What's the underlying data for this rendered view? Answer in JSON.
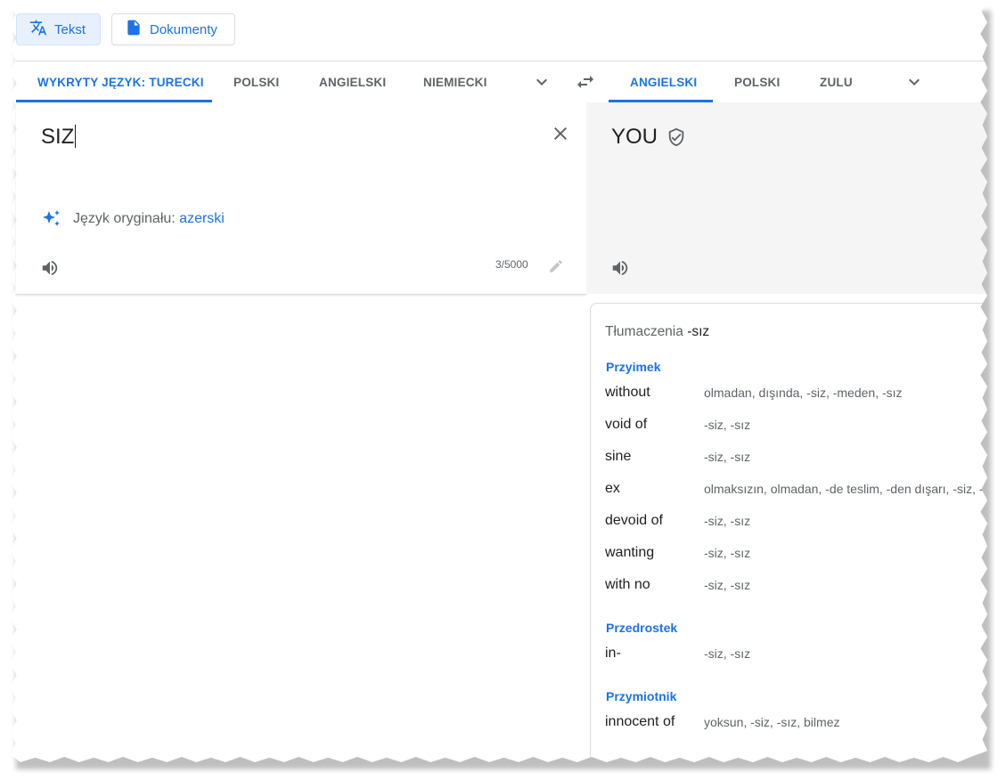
{
  "modes": {
    "text_label": "Tekst",
    "documents_label": "Dokumenty"
  },
  "source_langs": [
    {
      "label": "WYKRYTY JĘZYK: TURECKI",
      "active": true
    },
    {
      "label": "POLSKI",
      "active": false
    },
    {
      "label": "ANGIELSKI",
      "active": false
    },
    {
      "label": "NIEMIECKI",
      "active": false
    }
  ],
  "target_langs": [
    {
      "label": "ANGIELSKI",
      "active": true
    },
    {
      "label": "POLSKI",
      "active": false
    },
    {
      "label": "ZULU",
      "active": false
    }
  ],
  "source": {
    "text": "SIZ",
    "original_language_label": "Język oryginału:",
    "original_language_value": "azerski",
    "char_count": "3/5000"
  },
  "target": {
    "text": "YOU"
  },
  "translations": {
    "title": "Tłumaczenia",
    "word": "-sız",
    "groups": [
      {
        "pos": "Przyimek",
        "entries": [
          {
            "term": "without",
            "alts": "olmadan, dışında, -siz, -meden, -sız"
          },
          {
            "term": "void of",
            "alts": "-siz, -sız"
          },
          {
            "term": "sine",
            "alts": "-siz, -sız"
          },
          {
            "term": "ex",
            "alts": "olmaksızın, olmadan, -de teslim, -den dışarı, -siz, -sız"
          },
          {
            "term": "devoid of",
            "alts": "-siz, -sız"
          },
          {
            "term": "wanting",
            "alts": "-siz, -sız"
          },
          {
            "term": "with no",
            "alts": "-siz, -sız"
          }
        ]
      },
      {
        "pos": "Przedrostek",
        "entries": [
          {
            "term": "in-",
            "alts": "-siz, -sız"
          }
        ]
      },
      {
        "pos": "Przymiotnik",
        "entries": [
          {
            "term": "innocent of",
            "alts": "yoksun, -siz, -sız, bilmez"
          }
        ]
      }
    ]
  },
  "colors": {
    "accent": "#1a73e8",
    "muted_text": "#5f6368",
    "target_bg": "#f5f5f5"
  },
  "icons": [
    "translate-icon",
    "document-icon",
    "chevron-down-icon",
    "swap-icon",
    "close-icon",
    "sparkle-icon",
    "speaker-icon",
    "pencil-icon",
    "verified-shield-icon"
  ]
}
